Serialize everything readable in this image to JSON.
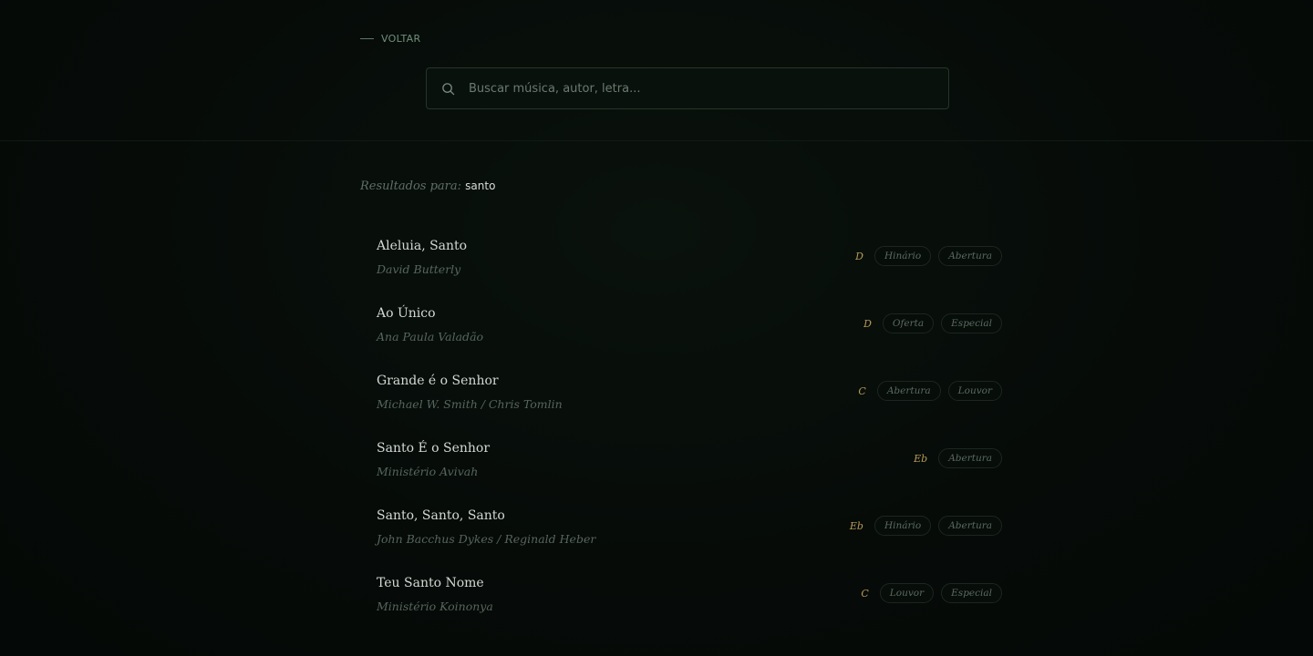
{
  "header": {
    "back_label": "VOLTAR",
    "search": {
      "placeholder": "Buscar música, autor, letra...",
      "value": ""
    }
  },
  "results": {
    "prefix": "Resultados para:",
    "query": "santo",
    "items": [
      {
        "title": "Aleluia, Santo",
        "author": "David Butterly",
        "key": "D",
        "tags": [
          "Hinário",
          "Abertura"
        ]
      },
      {
        "title": "Ao Único",
        "author": "Ana Paula Valadão",
        "key": "D",
        "tags": [
          "Oferta",
          "Especial"
        ]
      },
      {
        "title": "Grande é o Senhor",
        "author": "Michael W. Smith / Chris Tomlin",
        "key": "C",
        "tags": [
          "Abertura",
          "Louvor"
        ]
      },
      {
        "title": "Santo É o Senhor",
        "author": "Ministério Avivah",
        "key": "Eb",
        "tags": [
          "Abertura"
        ]
      },
      {
        "title": "Santo, Santo, Santo",
        "author": "John Bacchus Dykes / Reginald Heber",
        "key": "Eb",
        "tags": [
          "Hinário",
          "Abertura"
        ]
      },
      {
        "title": "Teu Santo Nome",
        "author": "Ministério Koinonya",
        "key": "C",
        "tags": [
          "Louvor",
          "Especial"
        ]
      }
    ]
  },
  "colors": {
    "background": "#050a07",
    "accent_key": "#b79a58",
    "text_primary": "#d3d9d4",
    "text_muted": "#56665d"
  },
  "icons": {
    "search": "search-icon"
  }
}
